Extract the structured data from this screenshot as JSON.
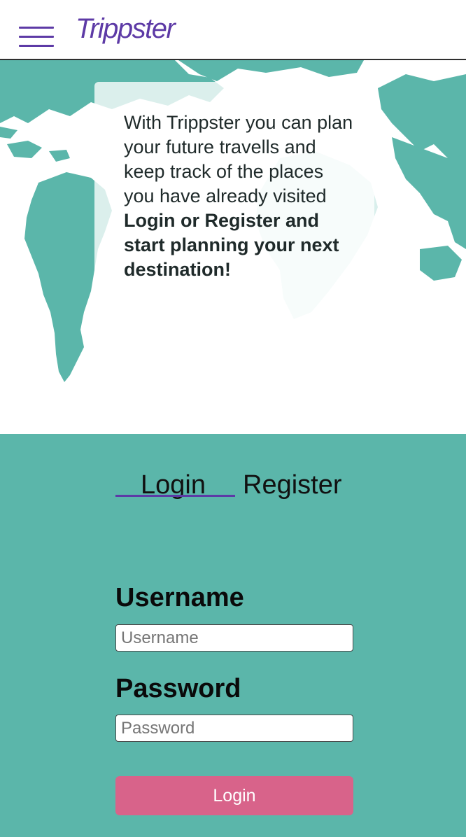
{
  "header": {
    "brand": "Trippster",
    "menu_icon": "hamburger-menu-icon"
  },
  "hero": {
    "background_icon": "world-map",
    "intro_plain": "With Trippster you can plan your future travells and keep track of the places you have already visited ",
    "intro_bold": "Login or Register and start planning your next destination!"
  },
  "auth": {
    "tabs": {
      "login": "Login",
      "register": "Register",
      "active": "Login"
    },
    "username": {
      "label": "Username",
      "placeholder": "Username",
      "value": ""
    },
    "password": {
      "label": "Password",
      "placeholder": "Password",
      "value": ""
    },
    "submit_label": "Login"
  },
  "colors": {
    "brand_purple": "#5d3aa6",
    "teal": "#5bb6aa",
    "button_pink": "#d8638a",
    "map_light": "#d9efec"
  }
}
